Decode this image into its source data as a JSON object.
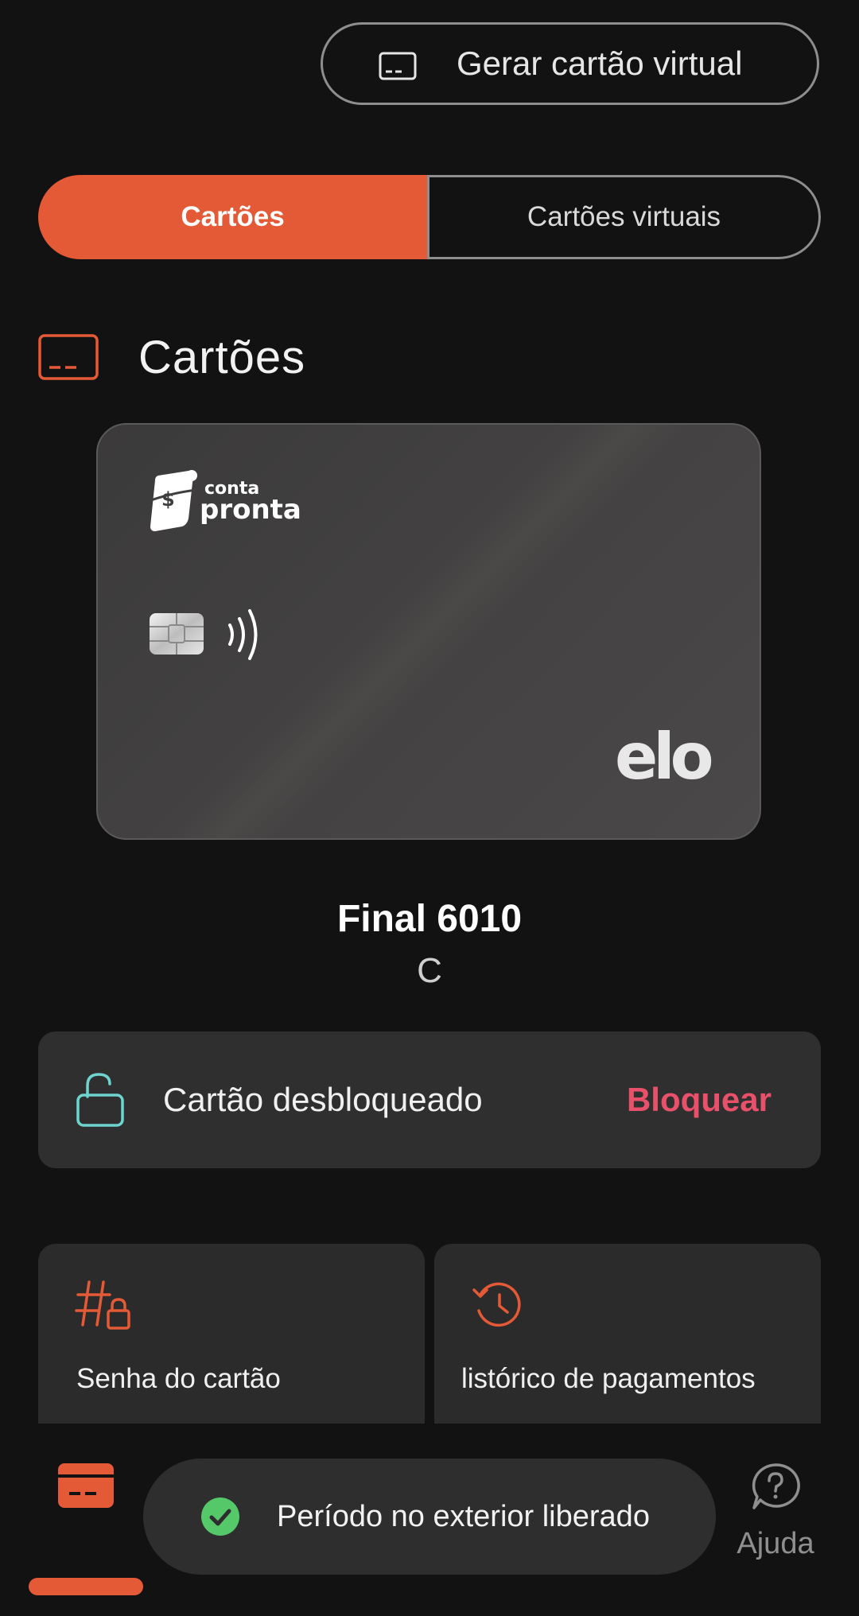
{
  "header": {
    "generate_button_label": "Gerar cartão virtual"
  },
  "tabs": [
    {
      "label": "Cartões",
      "active": true
    },
    {
      "label": "Cartões virtuais",
      "active": false
    }
  ],
  "section": {
    "title": "Cartões"
  },
  "card": {
    "logo_line1": "conta",
    "logo_line2": "pronta",
    "brand": "elo",
    "final_label": "Final 6010",
    "holder": "C"
  },
  "lock_panel": {
    "status": "Cartão desbloqueado",
    "action": "Bloquear"
  },
  "options": [
    {
      "label": "Senha do cartão",
      "icon": "hash-lock-icon"
    },
    {
      "label": "Histórico de pagamentos",
      "visible_label": "listórico de pagamentos",
      "icon": "history-icon"
    }
  ],
  "toast": {
    "message": "Período no exterior liberado"
  },
  "bottom_nav": {
    "help_label": "Ajuda"
  },
  "colors": {
    "accent": "#e55a36",
    "danger": "#e9506a",
    "teal": "#6fd3cf",
    "success": "#55c86a",
    "background": "#121212",
    "panel": "#2f2f2f"
  }
}
